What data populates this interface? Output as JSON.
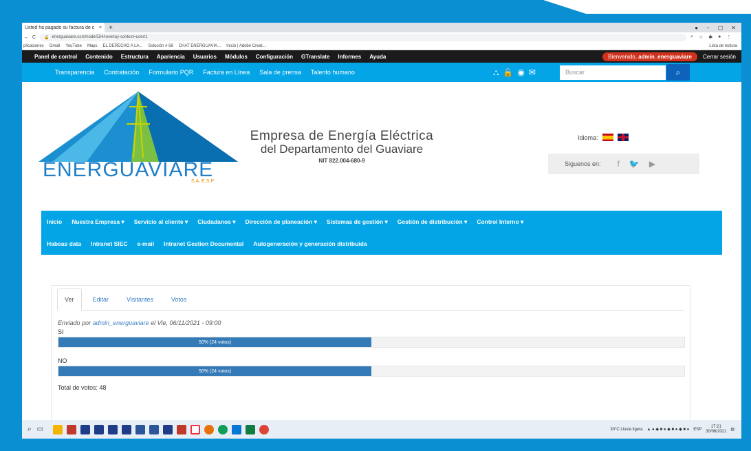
{
  "browser": {
    "tab_title": "Usted ha pagado su factura de c",
    "tab_close": "×",
    "new_tab": "+",
    "url": "energuaviare.com/node/554#overlay-context=user/1",
    "bookmarks": [
      "plicaciones",
      "Gmail",
      "YouTube",
      "Maps",
      "EL DERECHO A LA...",
      "Solución # 68",
      "CHAT ENERGUAVIA...",
      "Inicio | Adobe Creat..."
    ],
    "reading_list": "Lista de lectura"
  },
  "adminbar": {
    "items": [
      "Panel de control",
      "Contenido",
      "Estructura",
      "Apariencia",
      "Usuarios",
      "Módulos",
      "Configuración",
      "GTranslate",
      "Informes",
      "Ayuda"
    ],
    "welcome_prefix": "Bienvenido,",
    "welcome_user": "admin_energuaviare",
    "logout": "Cerrar sesión"
  },
  "topbar": {
    "links": [
      "Transparencia",
      "Contratación",
      "Formulario PQR",
      "Factura en Línea",
      "Sala de prensa",
      "Talento humano"
    ],
    "search_placeholder": "Buscar"
  },
  "header": {
    "logo_text": "ENERGUAVIARE",
    "logo_sub": "S.A. E.S.P",
    "company_line1": "Empresa de Energía Eléctrica",
    "company_line2": "del Departamento del Guaviare",
    "nit": "NIT 822.004-680-9",
    "idioma_label": "Idioma:",
    "social_label": "Siguenos en:"
  },
  "mainnav": {
    "row1": [
      "Inicio",
      "Nuestra Empresa ▾",
      "Servicio al cliente ▾",
      "Ciudadanos ▾",
      "Dirección de planeación ▾",
      "Sistemas de gestión ▾",
      "Gestión de distribución ▾",
      "Control Interno ▾"
    ],
    "row2": [
      "Habeas data",
      "Intranet SIEC",
      "e-mail",
      "Intranet Gestion Documental",
      "Autogeneración y generación distribuida"
    ]
  },
  "poll": {
    "tabs": [
      "Ver",
      "Editar",
      "Visitantes",
      "Votos"
    ],
    "byline_prefix": "Enviado por",
    "author": "admin_energuaviare",
    "byline_suffix": "el Vie, 06/11/2021 - 09:00",
    "options": [
      {
        "label": "SI",
        "percent": 50,
        "bar_text": "50% (24 votos)"
      },
      {
        "label": "NO",
        "percent": 50,
        "bar_text": "50% (24 votos)"
      }
    ],
    "total": "Total de votos: 48"
  },
  "taskbar": {
    "weather": "30°C Lluvia ligera",
    "lang": "ESP",
    "time": "17:21",
    "date": "30/06/2021"
  },
  "colors": {
    "accent": "#03a5e6",
    "admin_bar": "#1b1b1b",
    "welcome": "#d0321e",
    "progress": "#337ab7",
    "search_button": "#0c63b9"
  }
}
